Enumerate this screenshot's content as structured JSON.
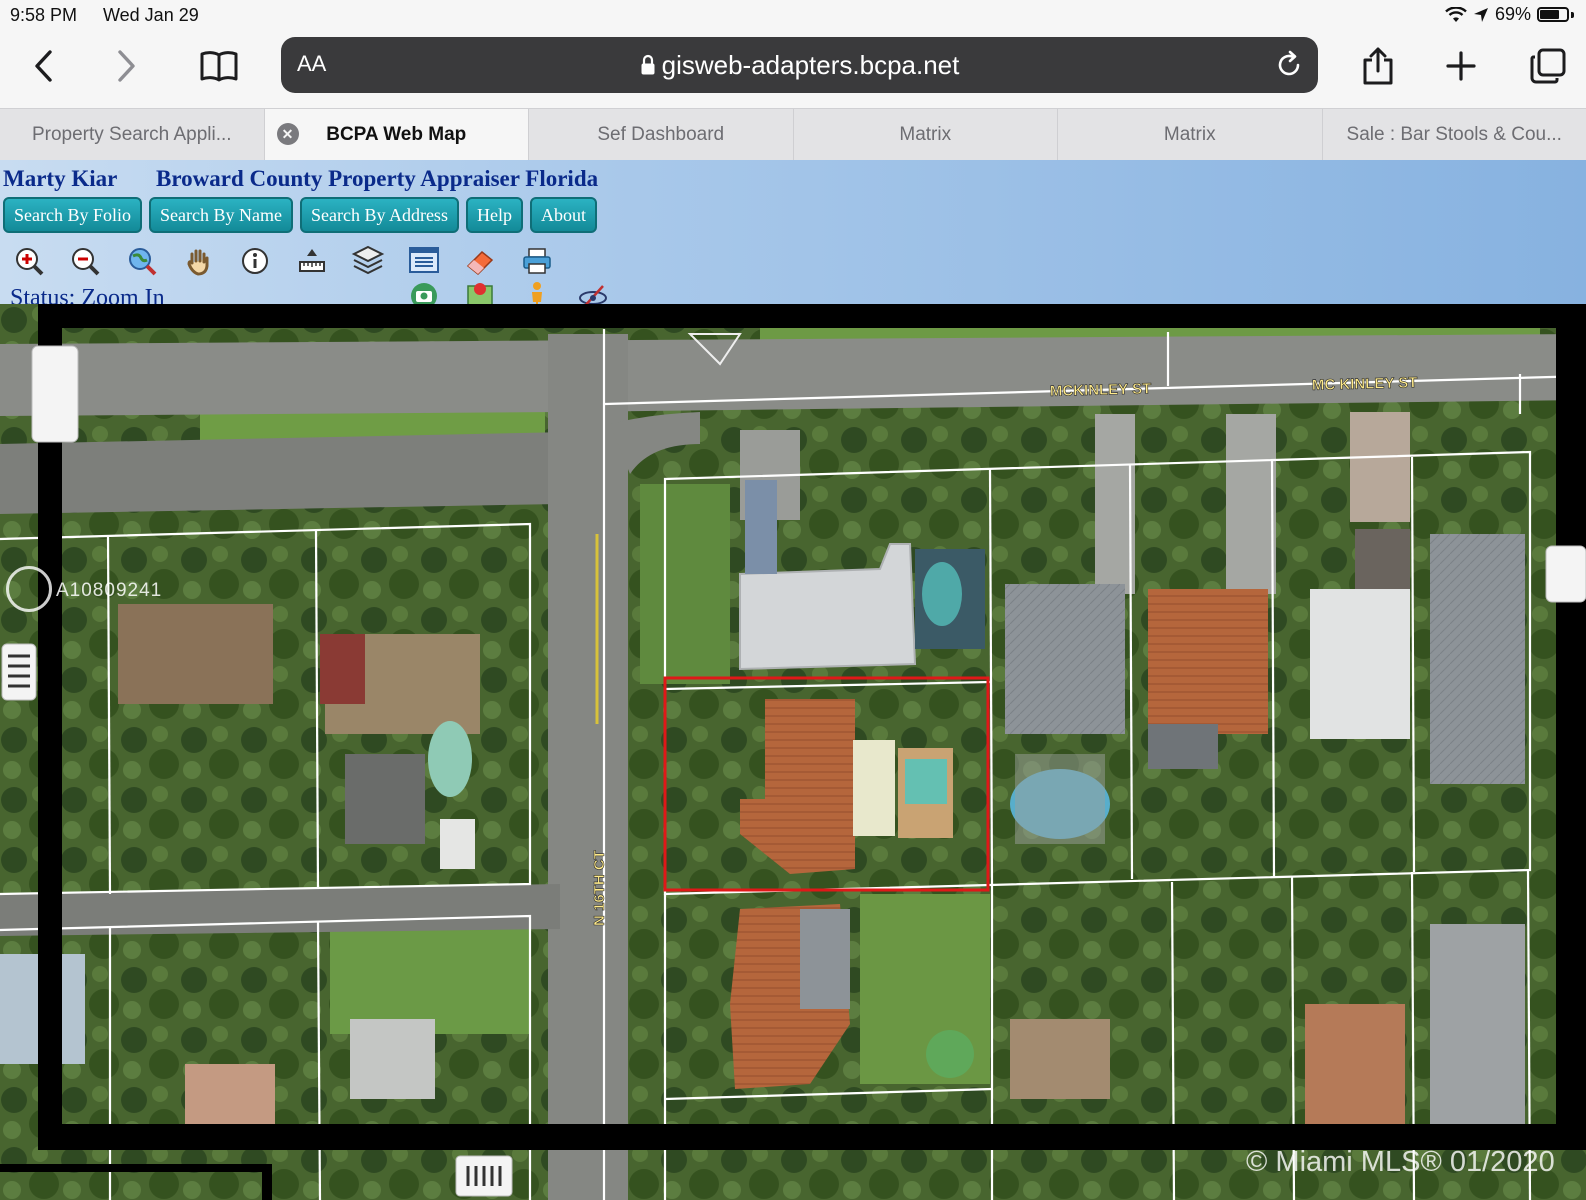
{
  "statusbar": {
    "time": "9:58 PM",
    "date": "Wed Jan 29",
    "battery": "69%"
  },
  "browser": {
    "text_size_label": "AA",
    "url": "gisweb-adapters.bcpa.net",
    "tabs": [
      {
        "label": "Property Search Appli..."
      },
      {
        "label": "BCPA Web Map"
      },
      {
        "label": "Sef Dashboard"
      },
      {
        "label": "Matrix"
      },
      {
        "label": "Matrix"
      },
      {
        "label": "Sale : Bar Stools & Cou..."
      }
    ]
  },
  "site": {
    "name": "Marty Kiar",
    "org": "Broward County Property Appraiser Florida",
    "nav": {
      "folio": "Search By Folio",
      "name": "Search By Name",
      "address": "Search By Address",
      "help": "Help",
      "about": "About"
    },
    "status": "Status: Zoom In"
  },
  "map": {
    "streets": {
      "mckinley_left": "MCKINLEY ST",
      "mckinley_right": "MC KINLEY ST",
      "n16th": "N 16TH CT"
    },
    "watermark_id": "A10809241",
    "watermark_mls": "© Miami MLS® 01/2020",
    "colors": {
      "highlight": "#e01818",
      "parcel_line": "#ffffff"
    }
  }
}
